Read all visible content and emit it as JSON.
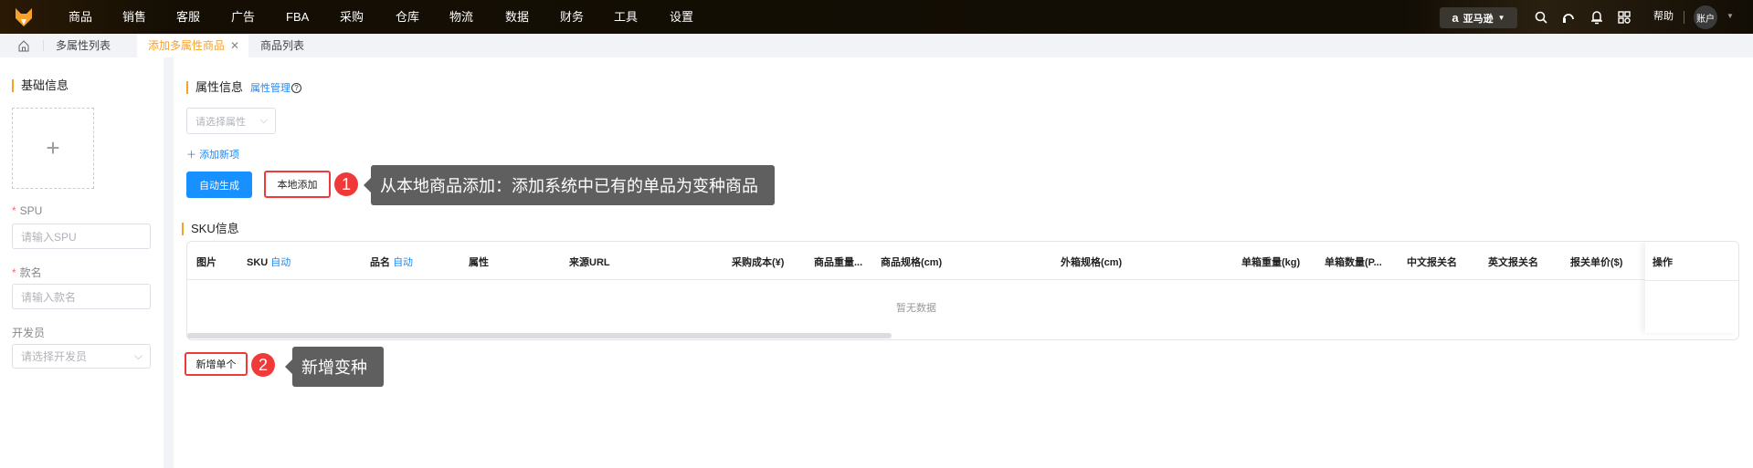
{
  "nav": {
    "items": [
      "商品",
      "销售",
      "客服",
      "广告",
      "FBA",
      "采购",
      "仓库",
      "物流",
      "数据",
      "财务",
      "工具",
      "设置"
    ],
    "platform": "亚马逊",
    "help": "帮助",
    "account": "账户"
  },
  "tabs": [
    {
      "label": "多属性列表"
    },
    {
      "label": "添加多属性商品",
      "active": true
    },
    {
      "label": "商品列表"
    }
  ],
  "sidebar": {
    "title": "基础信息",
    "spu_label": "SPU",
    "spu_placeholder": "请输入SPU",
    "name_label": "款名",
    "name_placeholder": "请输入款名",
    "dev_label": "开发员",
    "dev_placeholder": "请选择开发员"
  },
  "attr": {
    "title": "属性信息",
    "manage": "属性管理",
    "select_placeholder": "请选择属性",
    "add_item": "添加新项",
    "auto_btn": "自动生成",
    "local_btn": "本地添加"
  },
  "sku": {
    "title": "SKU信息",
    "auto": "自动",
    "columns": [
      "图片",
      "SKU",
      "品名",
      "属性",
      "来源URL",
      "采购成本(¥)",
      "商品重量...",
      "商品规格(cm)",
      "外箱规格(cm)",
      "单箱重量(kg)",
      "单箱数量(P...",
      "中文报关名",
      "英文报关名",
      "报关单价($)",
      "操作"
    ],
    "empty": "暂无数据",
    "add_single": "新增单个"
  },
  "annotations": [
    {
      "number": "1",
      "text": "从本地商品添加：添加系统中已有的单品为变种商品"
    },
    {
      "number": "2",
      "text": "新增变种"
    }
  ],
  "colors": {
    "accent": "#1e88f5",
    "primary_button": "#1890ff",
    "highlight": "#f7a12d",
    "annotation_red": "#f03a3a"
  }
}
